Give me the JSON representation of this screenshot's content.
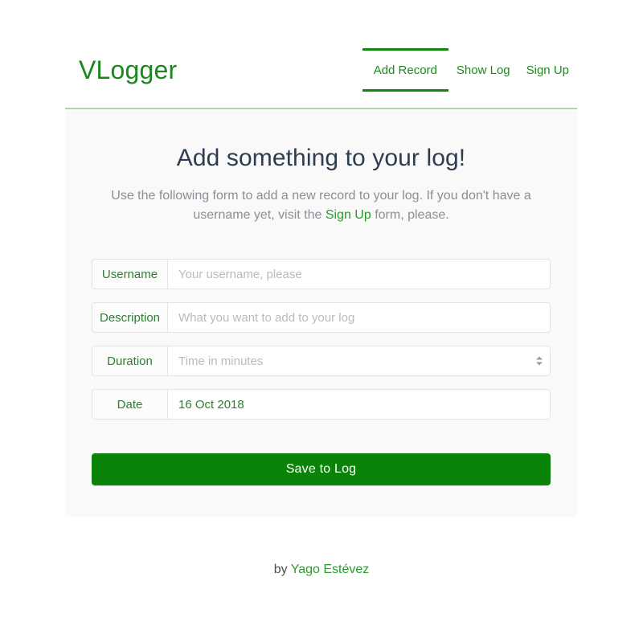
{
  "header": {
    "logo": "VLogger",
    "nav": [
      {
        "label": "Add Record",
        "active": true
      },
      {
        "label": "Show Log",
        "active": false
      },
      {
        "label": "Sign Up",
        "active": false
      }
    ]
  },
  "main": {
    "title": "Add something to your log!",
    "subtitle_before": "Use the following form to add a new record to your log. If you don't have a username yet, visit the ",
    "subtitle_link": "Sign Up",
    "subtitle_after": " form, please."
  },
  "form": {
    "fields": [
      {
        "label": "Username",
        "placeholder": "Your username, please",
        "value": "",
        "type": "text"
      },
      {
        "label": "Description",
        "placeholder": "What you want to add to your log",
        "value": "",
        "type": "text"
      },
      {
        "label": "Duration",
        "placeholder": "Time in minutes",
        "value": "",
        "type": "number"
      },
      {
        "label": "Date",
        "placeholder": "",
        "value": "16 Oct 2018",
        "type": "date"
      }
    ],
    "submit_label": "Save to Log"
  },
  "footer": {
    "prefix": "by ",
    "author": "Yago Estévez"
  },
  "colors": {
    "brand_green": "#0a8308",
    "link_green": "#2a9a2a",
    "label_green": "#2f7d32",
    "title_navy": "#2e3d4f",
    "panel_bg": "#f9f9fa",
    "placeholder_gray": "#b6bdb6"
  }
}
